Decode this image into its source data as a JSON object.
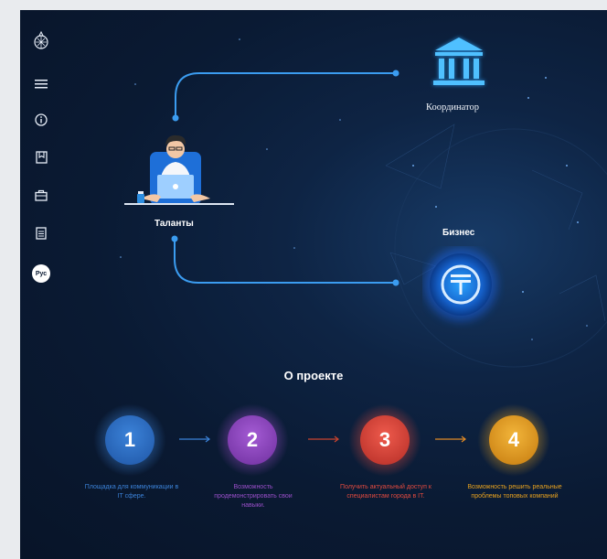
{
  "sidebar": {
    "logo": "globe-logo",
    "items": [
      {
        "name": "menu-icon"
      },
      {
        "name": "info-icon"
      },
      {
        "name": "bookmark-icon"
      },
      {
        "name": "briefcase-icon"
      },
      {
        "name": "document-icon"
      }
    ],
    "language": "Рус"
  },
  "diagram": {
    "coordinator_label": "Координатор",
    "talents_label": "Таланты",
    "business_label": "Бизнес"
  },
  "about": {
    "title": "О проекте",
    "steps": [
      {
        "number": "1",
        "text": "Площадка для коммуникации в IT сфере.",
        "color": "#3b82d8"
      },
      {
        "number": "2",
        "text": "Возможность продемонстрировать свои навыки.",
        "color": "#9a4fc9"
      },
      {
        "number": "3",
        "text": "Получить актуальный доступ к специалистам города в IT.",
        "color": "#e24a3f"
      },
      {
        "number": "4",
        "text": "Возможность решить реальные проблемы топовых компаний",
        "color": "#e8a21e"
      }
    ]
  },
  "colors": {
    "background": "#0a1a33",
    "connector": "#3b9cf0",
    "accent": "#2d9bf5"
  }
}
